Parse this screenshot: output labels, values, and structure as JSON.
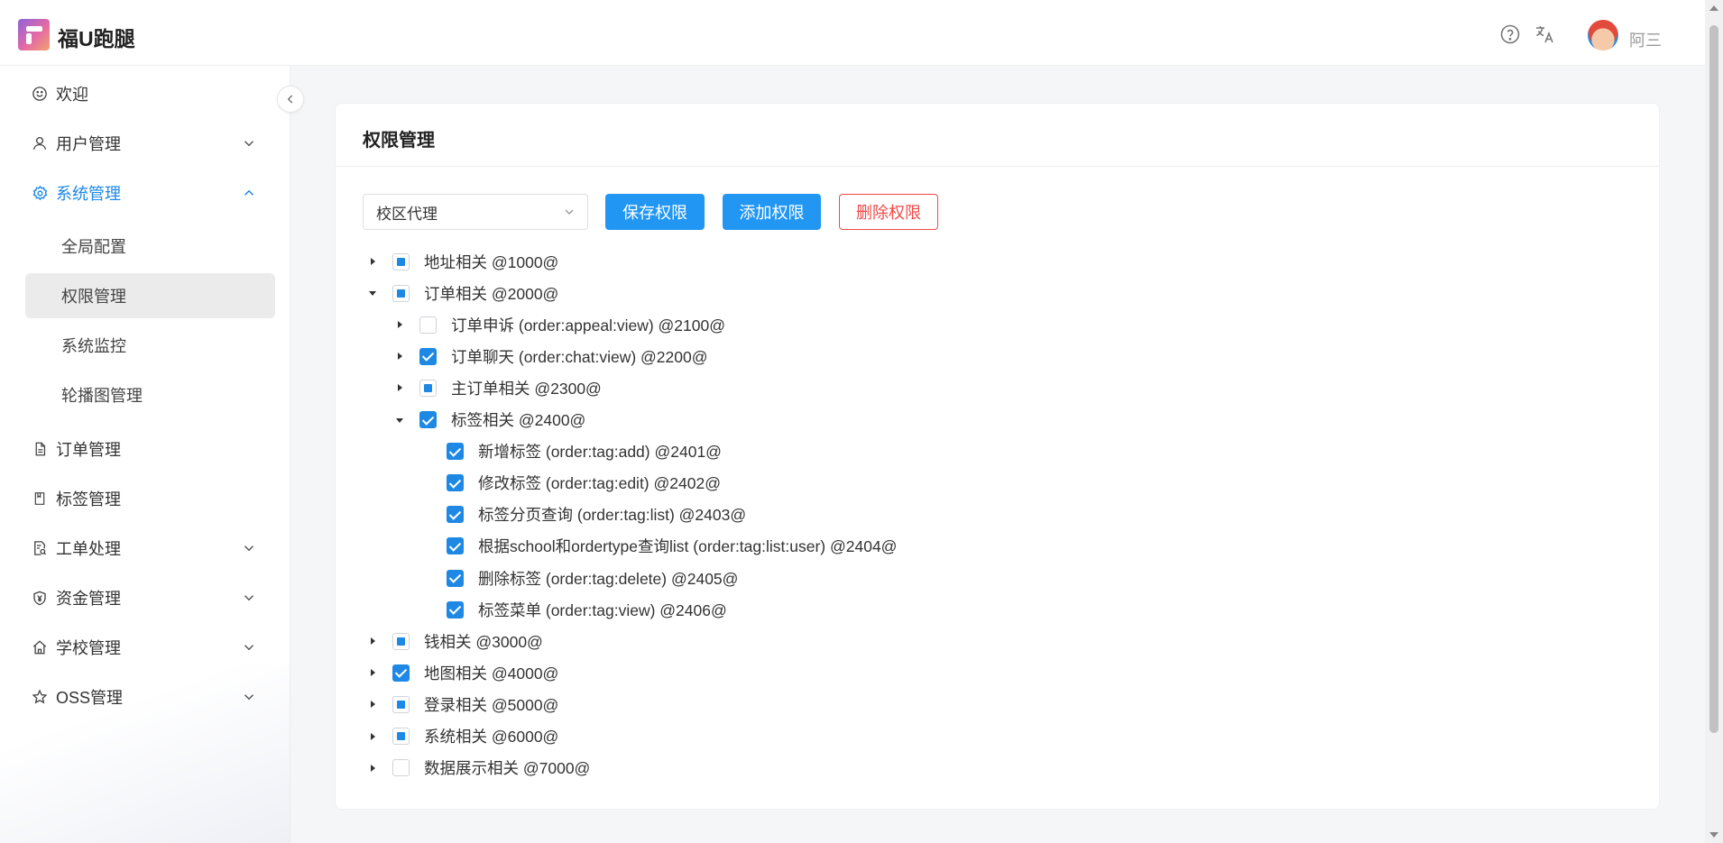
{
  "app": {
    "title": "福U跑腿"
  },
  "header": {
    "user_name": "阿三"
  },
  "sidebar": {
    "items": [
      {
        "label": "欢迎"
      },
      {
        "label": "用户管理"
      },
      {
        "label": "系统管理"
      },
      {
        "label": "订单管理"
      },
      {
        "label": "标签管理"
      },
      {
        "label": "工单处理"
      },
      {
        "label": "资金管理"
      },
      {
        "label": "学校管理"
      },
      {
        "label": "OSS管理"
      }
    ],
    "sub_items": [
      {
        "label": "全局配置"
      },
      {
        "label": "权限管理"
      },
      {
        "label": "系统监控"
      },
      {
        "label": "轮播图管理"
      }
    ]
  },
  "panel": {
    "title": "权限管理",
    "role_select": {
      "value": "校区代理"
    },
    "buttons": {
      "save": "保存权限",
      "add": "添加权限",
      "delete": "删除权限"
    }
  },
  "tree": [
    {
      "label": "地址相关 @1000@",
      "state": "partial",
      "expanded": false
    },
    {
      "label": "订单相关 @2000@",
      "state": "partial",
      "expanded": true
    },
    {
      "label": "订单申诉 (order:appeal:view) @2100@",
      "state": "unchecked",
      "expanded": false
    },
    {
      "label": "订单聊天 (order:chat:view) @2200@",
      "state": "checked",
      "expanded": false
    },
    {
      "label": "主订单相关 @2300@",
      "state": "partial",
      "expanded": false
    },
    {
      "label": "标签相关 @2400@",
      "state": "checked",
      "expanded": true
    },
    {
      "label": "新增标签 (order:tag:add) @2401@",
      "state": "checked"
    },
    {
      "label": "修改标签 (order:tag:edit) @2402@",
      "state": "checked"
    },
    {
      "label": "标签分页查询 (order:tag:list) @2403@",
      "state": "checked"
    },
    {
      "label": "根据school和ordertype查询list (order:tag:list:user) @2404@",
      "state": "checked"
    },
    {
      "label": "删除标签 (order:tag:delete) @2405@",
      "state": "checked"
    },
    {
      "label": "标签菜单 (order:tag:view) @2406@",
      "state": "checked"
    },
    {
      "label": "钱相关 @3000@",
      "state": "partial",
      "expanded": false
    },
    {
      "label": "地图相关 @4000@",
      "state": "checked",
      "expanded": false
    },
    {
      "label": "登录相关 @5000@",
      "state": "partial",
      "expanded": false
    },
    {
      "label": "系统相关 @6000@",
      "state": "partial",
      "expanded": false
    },
    {
      "label": "数据展示相关 @7000@",
      "state": "unchecked",
      "expanded": false
    }
  ]
}
